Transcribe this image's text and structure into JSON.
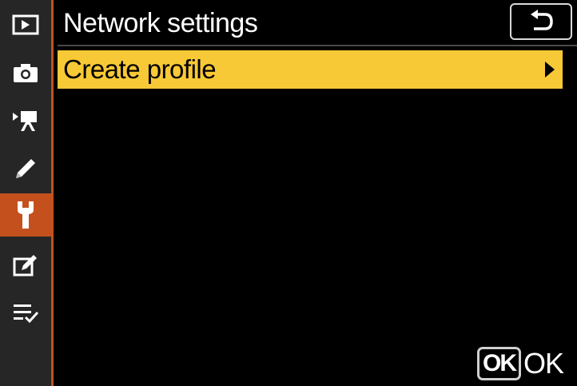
{
  "sidebar": {
    "items": [
      {
        "icon": "playback-icon",
        "active": false
      },
      {
        "icon": "camera-icon",
        "active": false
      },
      {
        "icon": "movie-camera-icon",
        "active": false
      },
      {
        "icon": "pencil-icon",
        "active": false
      },
      {
        "icon": "wrench-icon",
        "active": true
      },
      {
        "icon": "retouch-icon",
        "active": false
      },
      {
        "icon": "my-menu-icon",
        "active": false
      }
    ]
  },
  "header": {
    "title": "Network settings"
  },
  "menu": {
    "items": [
      {
        "label": "Create profile",
        "selected": true
      }
    ]
  },
  "footer": {
    "ok_badge": "OK",
    "ok_label": "OK"
  },
  "colors": {
    "accent": "#c4501e",
    "highlight": "#f8c936",
    "sidebar": "#262626",
    "background": "#000000"
  }
}
